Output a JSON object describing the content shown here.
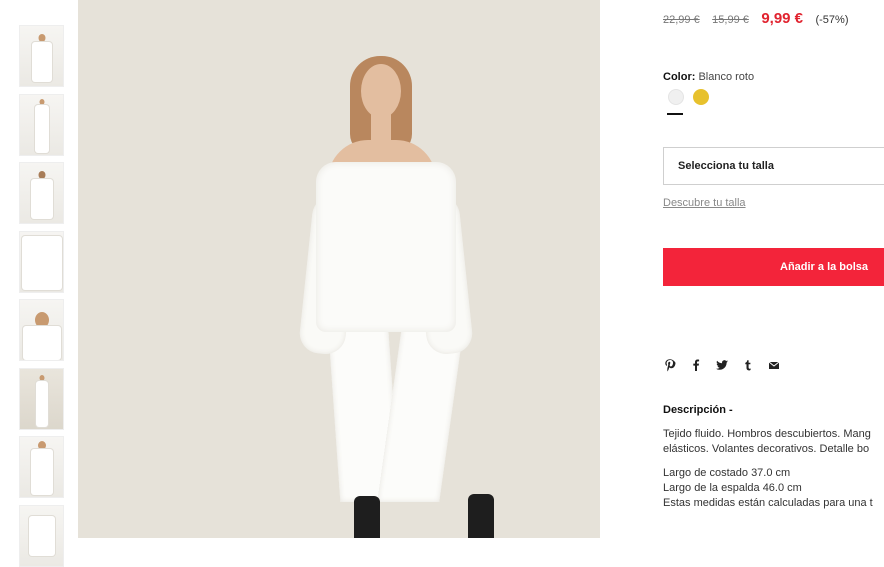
{
  "thumbnails": [
    {
      "name": "thumb-1"
    },
    {
      "name": "thumb-2"
    },
    {
      "name": "thumb-3"
    },
    {
      "name": "thumb-4"
    },
    {
      "name": "thumb-5"
    },
    {
      "name": "thumb-6"
    },
    {
      "name": "thumb-7"
    },
    {
      "name": "thumb-8"
    }
  ],
  "price": {
    "original": "22,99 €",
    "previous": "15,99 €",
    "current": "9,99 €",
    "discount": "(-57%)"
  },
  "color": {
    "label": "Color:",
    "value": "Blanco roto",
    "swatches": [
      {
        "name": "blanco-roto",
        "hex": "#f0f0f0",
        "selected": true
      },
      {
        "name": "amarillo",
        "hex": "#e7c12d",
        "selected": false
      }
    ]
  },
  "size": {
    "select_label": "Selecciona tu talla",
    "guide_link": "Descubre tu talla"
  },
  "add_to_bag": "Añadir a la bolsa",
  "share_icons": [
    "pinterest-icon",
    "facebook-icon",
    "twitter-icon",
    "tumblr-icon",
    "email-icon"
  ],
  "description": {
    "title": "Descripción -",
    "lines": [
      "Tejido fluido. Hombros descubiertos. Mang",
      "elásticos. Volantes decorativos. Detalle bo",
      "Largo de costado 37.0 cm",
      "Largo de la espalda 46.0 cm",
      "Estas medidas están calculadas para una t"
    ]
  },
  "colors": {
    "accent": "#f3243a",
    "price_sale": "#e1232f"
  }
}
